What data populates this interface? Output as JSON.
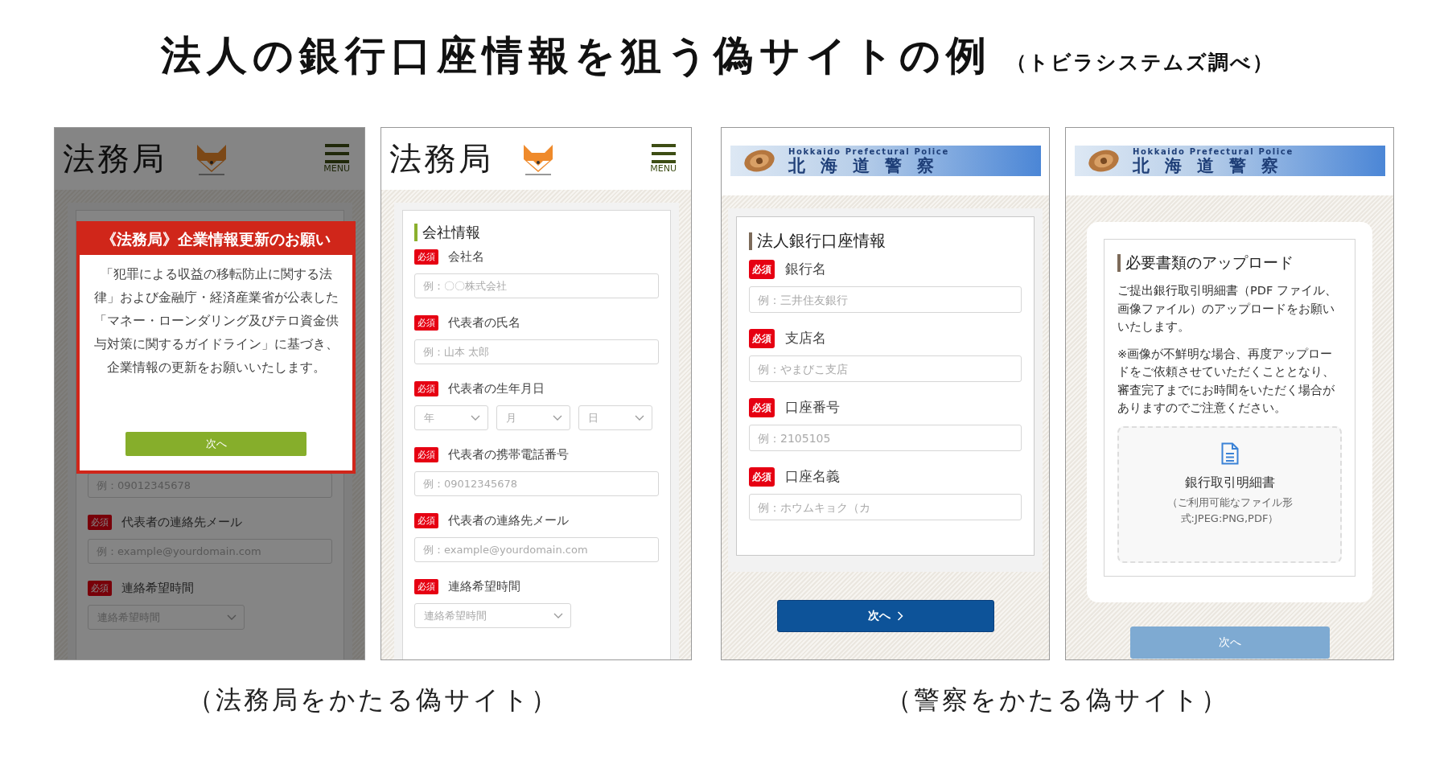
{
  "title": "法人の銀行口座情報を狙う偽サイトの例",
  "source_note": "（トビラシステムズ調べ）",
  "groups": [
    {
      "caption": "（法務局をかたる偽サイト）",
      "screens": [
        {
          "header": {
            "kind": "moj",
            "site_title": "法務局",
            "menu_label": "MENU"
          },
          "dimmed": true,
          "modal": {
            "title": "《法務局》企業情報更新のお願い",
            "message": "「犯罪による収益の移転防止に関する法律」および金融庁・経済産業省が公表した「マネー・ローンダリング及びテロ資金供与対策に関するガイドライン」に基づき、企業情報の更新をお願いいたします。",
            "button": "次へ"
          },
          "fields": [
            {
              "inputs": [
                {
                  "kind": "text",
                  "placeholder": "例：09012345678"
                }
              ]
            },
            {
              "badge": "必須",
              "label": "代表者の連絡先メール",
              "inputs": [
                {
                  "kind": "text",
                  "placeholder": "例：example@yourdomain.com"
                }
              ]
            },
            {
              "badge": "必須",
              "label": "連絡希望時間",
              "inputs": [
                {
                  "kind": "select",
                  "value": "連絡希望時間"
                }
              ]
            }
          ]
        },
        {
          "header": {
            "kind": "moj",
            "site_title": "法務局",
            "menu_label": "MENU"
          },
          "dimmed": false,
          "section_title": "会社情報",
          "fields": [
            {
              "badge": "必須",
              "label": "会社名",
              "inputs": [
                {
                  "kind": "text",
                  "placeholder": "例：〇〇株式会社"
                }
              ]
            },
            {
              "badge": "必須",
              "label": "代表者の氏名",
              "inputs": [
                {
                  "kind": "text",
                  "placeholder": "例：山本 太郎"
                }
              ]
            },
            {
              "badge": "必須",
              "label": "代表者の生年月日",
              "inputs": [
                {
                  "kind": "select",
                  "value": "年"
                },
                {
                  "kind": "select",
                  "value": "月"
                },
                {
                  "kind": "select",
                  "value": "日"
                }
              ]
            },
            {
              "badge": "必須",
              "label": "代表者の携帯電話番号",
              "inputs": [
                {
                  "kind": "text",
                  "placeholder": "例：09012345678"
                }
              ]
            },
            {
              "badge": "必須",
              "label": "代表者の連絡先メール",
              "inputs": [
                {
                  "kind": "text",
                  "placeholder": "例：example@yourdomain.com"
                }
              ]
            },
            {
              "badge": "必須",
              "label": "連絡希望時間",
              "inputs": [
                {
                  "kind": "select",
                  "value": "連絡希望時間"
                }
              ]
            }
          ]
        }
      ]
    },
    {
      "caption": "（警察をかたる偽サイト）",
      "screens": [
        {
          "header": {
            "kind": "police",
            "english_name": "Hokkaido Prefectural Police",
            "name": "北海道警察"
          },
          "dimmed": false,
          "section_title": "法人銀行口座情報",
          "fields": [
            {
              "badge": "必須",
              "label": "銀行名",
              "inputs": [
                {
                  "kind": "text",
                  "placeholder": "例：三井住友銀行"
                }
              ]
            },
            {
              "badge": "必須",
              "label": "支店名",
              "inputs": [
                {
                  "kind": "text",
                  "placeholder": "例：やまびこ支店"
                }
              ]
            },
            {
              "badge": "必須",
              "label": "口座番号",
              "inputs": [
                {
                  "kind": "text",
                  "placeholder": "例：2105105"
                }
              ]
            },
            {
              "badge": "必須",
              "label": "口座名義",
              "inputs": [
                {
                  "kind": "text",
                  "placeholder": "例：ホウムキョク（カ"
                }
              ]
            }
          ],
          "next_button": {
            "label": "次へ",
            "chevron": true,
            "disabled": false
          }
        },
        {
          "header": {
            "kind": "police",
            "english_name": "Hokkaido Prefectural Police",
            "name": "北海道警察"
          },
          "dimmed": false,
          "section_title": "必要書類のアップロード",
          "paragraphs": [
            "ご提出銀行取引明細書（PDF ファイル、画像ファイル）のアップロードをお願いいたします。",
            "※画像が不鮮明な場合、再度アップロードをご依頼させていただくこととなり、審査完了までにお時間をいただく場合がありますのでご注意ください。"
          ],
          "upload": {
            "file_name": "銀行取引明細書",
            "formats": "（ご利用可能なファイル形式:JPEG:PNG,PDF）"
          },
          "next_button": {
            "label": "次へ",
            "chevron": false,
            "disabled": true
          }
        }
      ]
    }
  ]
}
